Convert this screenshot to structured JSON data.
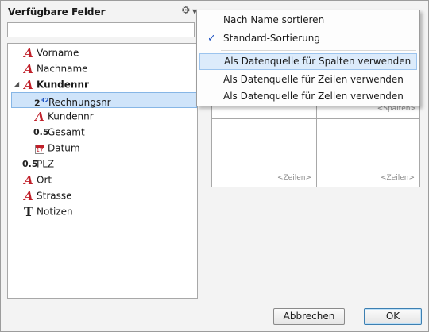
{
  "dialog": {
    "title": "Verfügbare Felder",
    "search_value": "",
    "search_placeholder": ""
  },
  "tree": {
    "items": [
      {
        "label": "Vorname",
        "icon": "text-field-icon"
      },
      {
        "label": "Nachname",
        "icon": "text-field-icon"
      },
      {
        "label": "Kundennr",
        "icon": "text-field-icon"
      },
      {
        "label": "Rechnungsnr",
        "icon": "integer-field-icon"
      },
      {
        "label": "Kundennr",
        "icon": "text-field-icon"
      },
      {
        "label": "Gesamt",
        "icon": "decimal-field-icon"
      },
      {
        "label": "Datum",
        "icon": "date-field-icon"
      },
      {
        "label": "PLZ",
        "icon": "decimal-field-icon"
      },
      {
        "label": "Ort",
        "icon": "text-field-icon"
      },
      {
        "label": "Strasse",
        "icon": "text-field-icon"
      },
      {
        "label": "Notizen",
        "icon": "memo-field-icon"
      }
    ],
    "icon_glyphs": {
      "text": "A",
      "int_base": "2",
      "int_sup": "32",
      "decimal": "0.5",
      "memo": "T",
      "cal": "17"
    }
  },
  "menu": {
    "items": [
      {
        "label": "Nach Name sortieren",
        "checked": false
      },
      {
        "label": "Standard-Sortierung",
        "checked": true
      },
      {
        "label": "Als Datenquelle für Spalten verwenden",
        "checked": false
      },
      {
        "label": "Als Datenquelle für Zeilen verwenden",
        "checked": false
      },
      {
        "label": "Als Datenquelle für Zellen verwenden",
        "checked": false
      }
    ],
    "check_glyph": "✓"
  },
  "grid": {
    "spalten": "<Spalten>",
    "zeilen_left": "<Zeilen>",
    "zeilen_right": "<Zeilen>"
  },
  "buttons": {
    "cancel": "Abbrechen",
    "ok": "OK"
  },
  "colors": {
    "accent": "#1a4fc0",
    "text_icon": "#c0202a",
    "selection": "#cfe4fa"
  }
}
